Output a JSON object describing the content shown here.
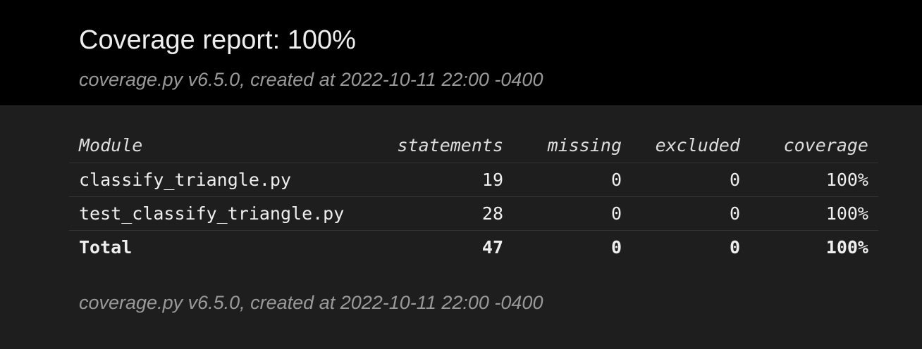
{
  "header": {
    "title": "Coverage report: 100%",
    "created": "coverage.py v6.5.0, created at 2022-10-11 22:00 -0400"
  },
  "table": {
    "headers": {
      "module": "Module",
      "statements": "statements",
      "missing": "missing",
      "excluded": "excluded",
      "coverage": "coverage"
    },
    "rows": [
      {
        "module": "classify_triangle.py",
        "statements": "19",
        "missing": "0",
        "excluded": "0",
        "coverage": "100%"
      },
      {
        "module": "test_classify_triangle.py",
        "statements": "28",
        "missing": "0",
        "excluded": "0",
        "coverage": "100%"
      }
    ],
    "total": {
      "module": "Total",
      "statements": "47",
      "missing": "0",
      "excluded": "0",
      "coverage": "100%"
    }
  },
  "footer": {
    "created": "coverage.py v6.5.0, created at 2022-10-11 22:00 -0400"
  },
  "colors": {
    "header_bg": "#000000",
    "content_bg": "#1e1e1e",
    "text": "#eeeeee",
    "muted_text": "#999999",
    "rule": "#333333"
  }
}
